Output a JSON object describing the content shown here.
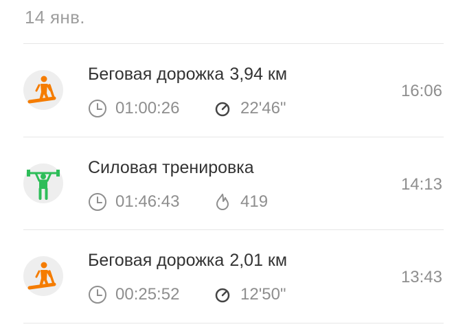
{
  "date_header": "14 янв.",
  "colors": {
    "treadmill": "#f57c00",
    "strength": "#2ebd59",
    "icon_gray": "#8e8e8e"
  },
  "workouts": [
    {
      "title": "Беговая дорожка",
      "distance": "3,94 км",
      "icon": "treadmill-icon",
      "duration": "01:00:26",
      "secondary": "22'46\"",
      "secondary_icon": "speedometer-icon",
      "time": "16:06"
    },
    {
      "title": "Силовая тренировка",
      "distance": "",
      "icon": "weightlifting-icon",
      "duration": "01:46:43",
      "secondary": "419",
      "secondary_icon": "flame-icon",
      "time": "14:13"
    },
    {
      "title": "Беговая дорожка",
      "distance": "2,01 км",
      "icon": "treadmill-icon",
      "duration": "00:25:52",
      "secondary": "12'50\"",
      "secondary_icon": "speedometer-icon",
      "time": "13:43"
    }
  ]
}
